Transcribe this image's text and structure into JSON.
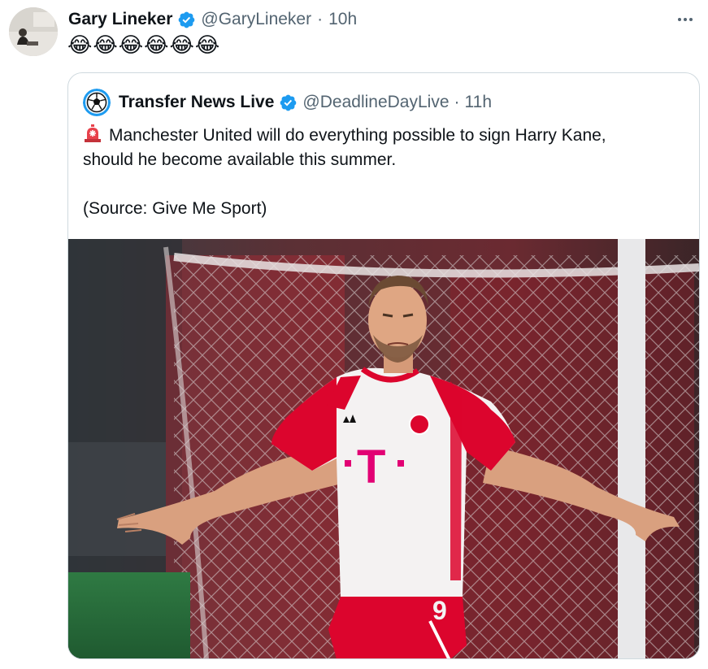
{
  "tweet": {
    "author_name": "Gary Lineker",
    "author_handle": "@GaryLineker",
    "separator": "·",
    "time": "10h",
    "text": "😂😂😂😂😂😂",
    "verified": true,
    "more_icon": "more-horizontal-icon"
  },
  "quote": {
    "author_name": "Transfer News Live",
    "author_handle": "@DeadlineDayLive",
    "separator": "·",
    "time": "11h",
    "verified": true,
    "alert_icon": "siren-icon",
    "line1": "Manchester United will do everything possible to sign Harry Kane,",
    "line2": "should he become available this summer.",
    "source": "(Source: Give Me Sport)",
    "media": {
      "shirt_logo": "T",
      "shirt_number": "9"
    }
  },
  "colors": {
    "text_primary": "#0f1419",
    "text_secondary": "#536471",
    "verified_blue": "#1d9bf0",
    "border": "#cfd9de",
    "jersey_red": "#dc052d"
  }
}
